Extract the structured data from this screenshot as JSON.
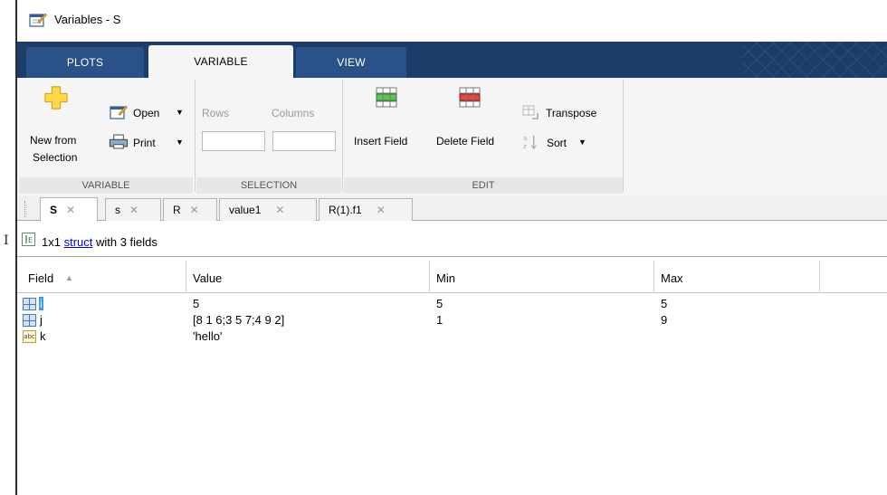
{
  "window": {
    "title": "Variables - S"
  },
  "toolstrip_tabs": [
    "PLOTS",
    "VARIABLE",
    "VIEW"
  ],
  "ribbon": {
    "new_from_selection": [
      "New from",
      "Selection"
    ],
    "open": "Open",
    "print": "Print",
    "variable_group": "VARIABLE",
    "rows": "Rows",
    "columns": "Columns",
    "selection_group": "SELECTION",
    "insert_field": "Insert Field",
    "delete_field": "Delete Field",
    "transpose": "Transpose",
    "sort": "Sort",
    "edit_group": "EDIT"
  },
  "doc_tabs": [
    {
      "label": "S",
      "active": true
    },
    {
      "label": "s",
      "active": false
    },
    {
      "label": "R",
      "active": false
    },
    {
      "label": "value1",
      "active": false
    },
    {
      "label": "R(1).f1",
      "active": false
    }
  ],
  "info": {
    "prefix": "1x1 ",
    "link": "struct",
    "suffix": " with 3 fields"
  },
  "table": {
    "columns": [
      "Field",
      "Value",
      "Min",
      "Max"
    ],
    "rows": [
      {
        "icon": "matrix-icon",
        "field": "i",
        "value": "5",
        "min": "5",
        "max": "5",
        "selected": true
      },
      {
        "icon": "matrix-icon",
        "field": "j",
        "value": "[8 1 6;3 5 7;4 9 2]",
        "min": "1",
        "max": "9",
        "selected": false
      },
      {
        "icon": "char-icon",
        "field": "k",
        "value": "'hello'",
        "min": "",
        "max": "",
        "selected": false
      }
    ]
  },
  "colors": {
    "toolstrip_bg": "#1c3c6a",
    "tab_bg": "#2a5289",
    "ribbon_bg": "#f5f5f5",
    "selection": "#3399ff",
    "link": "#0000ee"
  }
}
